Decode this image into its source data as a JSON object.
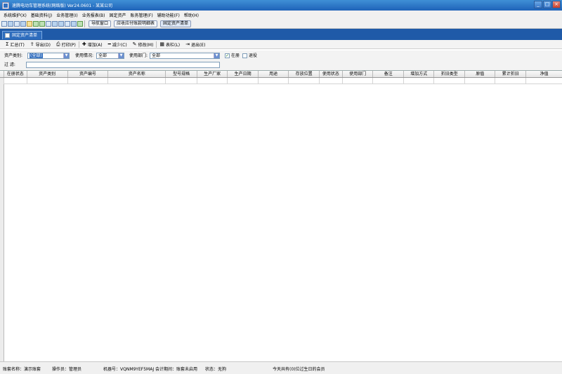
{
  "window": {
    "title": "速腾电动车管理系统(网络版) Ver24.0601 - 某某公司",
    "minimize_glyph": "_",
    "maximize_glyph": "□",
    "close_glyph": "×"
  },
  "menu": [
    "系统维护(X)",
    "基础资料(J)",
    "业务管理(I)",
    "业务报表(B)",
    "固定资产",
    "账务管理(F)",
    "辅助功能(F)",
    "帮助(H)"
  ],
  "toolbar": {
    "icons": [
      "new-icon",
      "open-icon",
      "window-icon",
      "list-icon",
      "edit-icon",
      "tools-icon",
      "refresh-icon",
      "settings-icon",
      "calendar-icon",
      "save-icon",
      "user-icon",
      "help-icon",
      "exit-icon"
    ],
    "links": [
      "导航窗口",
      "应收应付账款明细表",
      "固定资产清单"
    ]
  },
  "tab": {
    "label": "固定资产清单"
  },
  "actions": [
    {
      "glyph": "Σ",
      "label": "汇总(T)"
    },
    {
      "glyph": "⇪",
      "label": "导出(D)"
    },
    {
      "glyph": "⎙",
      "label": "打印(P)"
    },
    {
      "glyph": "✚",
      "label": "增加(A)"
    },
    {
      "glyph": "━",
      "label": "减少(C)"
    },
    {
      "glyph": "✎",
      "label": "修改(M)"
    },
    {
      "glyph": "▦",
      "label": "表栏(L)"
    },
    {
      "glyph": "⇥",
      "label": "退出(E)"
    }
  ],
  "filters": {
    "category_label": "资产类别:",
    "category_value": "(全部)",
    "usage_label": "使用情况:",
    "usage_value": "全部",
    "dept_label": "使用部门:",
    "dept_value": "全部",
    "in_book_label": "在册",
    "in_book_checked": true,
    "retired_label": "退役",
    "retired_checked": false,
    "filter_label": "过    滤:",
    "filter_value": ""
  },
  "table": {
    "columns": [
      "在册状态",
      "资产类别",
      "资产编号",
      "资产名称",
      "型号规格",
      "生产厂家",
      "生产日期",
      "用途",
      "存放位置",
      "使用状态",
      "使用部门",
      "备注",
      "增加方式",
      "折旧类型",
      "原值",
      "累计折旧",
      "净值"
    ]
  },
  "status": {
    "account": "账套名称：演示账套",
    "operator": "操作员：管理员",
    "machine": "机器号：VQNM9YEF5MAJ 会计期间：账套未启用",
    "state": "状态：无狗",
    "birthday": "今天共有(0)位过生日的会员"
  }
}
